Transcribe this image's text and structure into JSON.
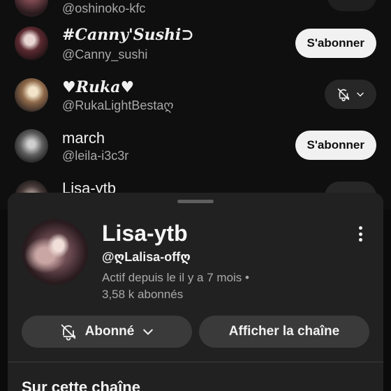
{
  "subscriptions": [
    {
      "name": "",
      "handle": "@oshinoko-kfc",
      "action": "partial"
    },
    {
      "name": "#Canny'Sushi⊃",
      "handle": "@Canny_sushi",
      "action": "S'abonner"
    },
    {
      "name": "♥Ruka♥",
      "handle": "@RukaLightBestaღ",
      "action": "bell"
    },
    {
      "name": "march",
      "handle": "@leila-i3c3r",
      "action": "S'abonner"
    },
    {
      "name": "Lisa-ytb",
      "handle": "",
      "action": "bell"
    }
  ],
  "sheet": {
    "channel_name": "Lisa-ytb",
    "channel_handle": "@ღLalisa-offღ",
    "meta_line1": "Actif depuis le il y a 7 mois •",
    "meta_line2": "3,58 k abonnés",
    "subscribed_label": "Abonné",
    "view_channel_label": "Afficher la chaîne",
    "section_title": "Sur cette chaîne"
  }
}
